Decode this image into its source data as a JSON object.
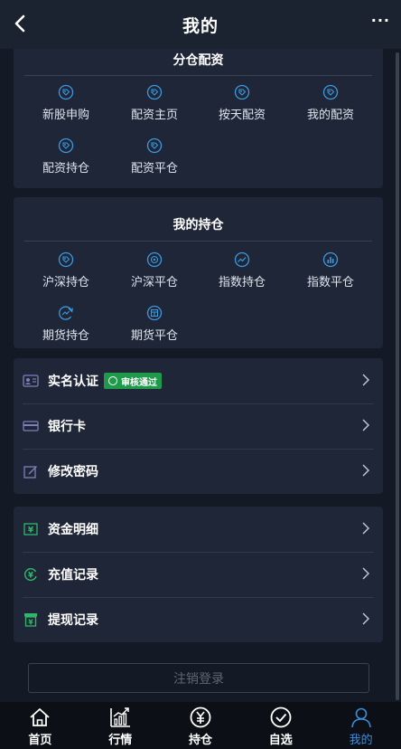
{
  "header": {
    "title": "我的",
    "more": "···"
  },
  "section_allocation": {
    "title": "分仓配资",
    "items": [
      {
        "label": "新股申购",
        "icon": "tag-icon"
      },
      {
        "label": "配资主页",
        "icon": "tag-icon"
      },
      {
        "label": "按天配资",
        "icon": "tag-icon"
      },
      {
        "label": "我的配资",
        "icon": "tag-icon"
      },
      {
        "label": "配资持仓",
        "icon": "tag-icon"
      },
      {
        "label": "配资平仓",
        "icon": "tag-icon"
      }
    ]
  },
  "section_positions": {
    "title": "我的持仓",
    "items": [
      {
        "label": "沪深持仓",
        "icon": "tag-icon"
      },
      {
        "label": "沪深平仓",
        "icon": "target-icon"
      },
      {
        "label": "指数持仓",
        "icon": "trend-icon"
      },
      {
        "label": "指数平仓",
        "icon": "bar-chart-icon"
      },
      {
        "label": "期货持仓",
        "icon": "refresh-icon"
      },
      {
        "label": "期货平仓",
        "icon": "calendar-icon"
      }
    ]
  },
  "account": {
    "items": [
      {
        "label": "实名认证",
        "icon": "id-card-icon",
        "badge": "审核通过"
      },
      {
        "label": "银行卡",
        "icon": "bank-card-icon"
      },
      {
        "label": "修改密码",
        "icon": "edit-icon"
      }
    ]
  },
  "funds": {
    "items": [
      {
        "label": "资金明细",
        "icon": "money-icon"
      },
      {
        "label": "充值记录",
        "icon": "recharge-icon"
      },
      {
        "label": "提现记录",
        "icon": "withdraw-icon"
      }
    ]
  },
  "logout_label": "注销登录",
  "tabs": [
    {
      "label": "首页",
      "icon": "home-icon",
      "active": false
    },
    {
      "label": "行情",
      "icon": "market-chart-icon",
      "active": false
    },
    {
      "label": "持仓",
      "icon": "yen-icon",
      "active": false
    },
    {
      "label": "自选",
      "icon": "check-circle-icon",
      "active": false
    },
    {
      "label": "我的",
      "icon": "user-icon",
      "active": true
    }
  ],
  "colors": {
    "accent": "#3b8ed8",
    "badge": "#1f9a4b",
    "card": "#1f2637",
    "background": "#131a25"
  }
}
